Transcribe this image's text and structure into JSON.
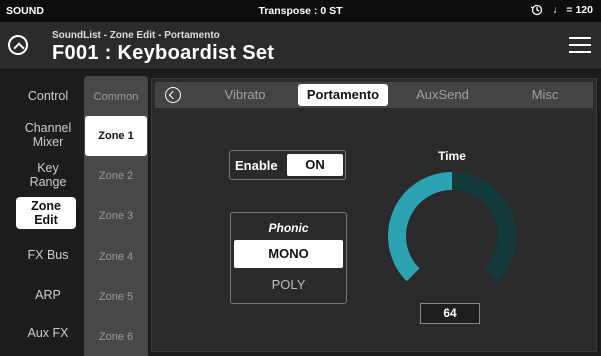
{
  "status": {
    "mode": "SOUND",
    "transpose": "Transpose : 0 ST",
    "tempo": "♩ = 120",
    "tempo_icon": "metronome-icon"
  },
  "header": {
    "breadcrumb": "SoundList - Zone Edit - Portamento",
    "title": "F001 : Keyboardist Set",
    "back_icon": "back-circle-icon",
    "menu_icon": "hamburger-menu-icon"
  },
  "categories": [
    {
      "label": "Control"
    },
    {
      "label": "Channel\nMixer"
    },
    {
      "label": "Key\nRange"
    },
    {
      "label": "Zone\nEdit"
    },
    {
      "label": "FX Bus"
    },
    {
      "label": "ARP"
    },
    {
      "label": "Aux FX"
    }
  ],
  "zones": [
    {
      "label": "Common"
    },
    {
      "label": "Zone 1"
    },
    {
      "label": "Zone 2"
    },
    {
      "label": "Zone 3"
    },
    {
      "label": "Zone 4"
    },
    {
      "label": "Zone 5"
    },
    {
      "label": "Zone 6"
    }
  ],
  "tabs": [
    {
      "label": "Vibrato"
    },
    {
      "label": "Portamento"
    },
    {
      "label": "AuxSend"
    },
    {
      "label": "Misc"
    }
  ],
  "portamento": {
    "enable_label": "Enable",
    "enable_value": "ON",
    "phonic_label": "Phonic",
    "phonic_options": [
      "MONO",
      "POLY"
    ],
    "phonic_selected": "MONO",
    "time_label": "Time",
    "time_value": "64",
    "time_fraction": 0.5
  },
  "colors": {
    "accent": "#2ba3b2",
    "accent_dark": "#123a3a",
    "active_bg": "#ffffff"
  }
}
